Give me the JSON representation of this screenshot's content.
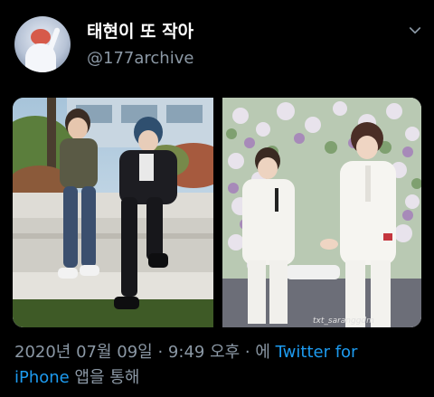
{
  "profile": {
    "display_name": "태현이 또 작아",
    "handle": "@177archive"
  },
  "photos": {
    "right_watermark": "txt_saranggdm"
  },
  "meta": {
    "date": "2020년 07월 09일",
    "separator1": " · ",
    "time": "9:49 오후",
    "separator2": " · ",
    "via_prefix": "에 ",
    "source_link_line1": "Twitter for",
    "source_link_line2": "iPhone",
    "via_suffix": " 앱을 통해"
  },
  "colors": {
    "background": "#000000",
    "primary_text": "#ffffff",
    "secondary_text": "#8b98a5",
    "link": "#1d9bf0"
  },
  "icons": {
    "menu": "chevron-down-icon"
  }
}
